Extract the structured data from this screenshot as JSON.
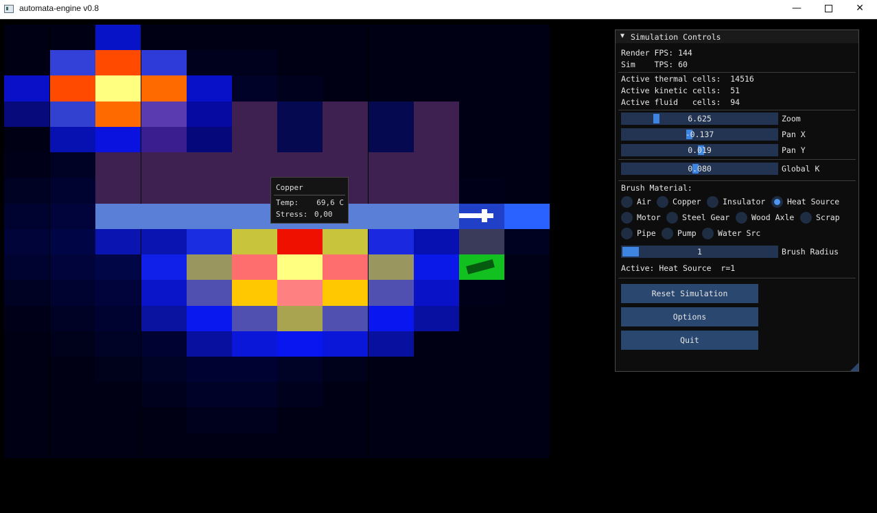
{
  "window": {
    "title": "automata-engine v0.8",
    "min_glyph": "—",
    "close_glyph": "✕"
  },
  "tooltip": {
    "title": "Copper",
    "temp_label": "Temp:",
    "temp_value": "69,6 C",
    "stress_label": "Stress:",
    "stress_value": "0,00"
  },
  "panel": {
    "collapse_glyph": "▼",
    "title": "Simulation Controls",
    "render_fps": "Render FPS: 144",
    "sim_tps": "Sim    TPS: 60",
    "thermal": "Active thermal cells:  14516",
    "kinetic": "Active kinetic cells:  51",
    "fluid": "Active fluid   cells:  94",
    "sliders": [
      {
        "label": "Zoom",
        "value": "6.625",
        "fraction": 0.21
      },
      {
        "label": "Pan X",
        "value": "-0.137",
        "fraction": 0.43
      },
      {
        "label": "Pan Y",
        "value": "0.019",
        "fraction": 0.51
      },
      {
        "label": "Global K",
        "value": "0.080",
        "fraction": 0.47
      }
    ],
    "brush_material_label": "Brush Material:",
    "materials": [
      {
        "label": "Air",
        "selected": false
      },
      {
        "label": "Copper",
        "selected": false
      },
      {
        "label": "Insulator",
        "selected": false
      },
      {
        "label": "Heat Source",
        "selected": true
      },
      {
        "label": "Motor",
        "selected": false
      },
      {
        "label": "Steel Gear",
        "selected": false
      },
      {
        "label": "Wood Axle",
        "selected": false
      },
      {
        "label": "Scrap",
        "selected": false
      },
      {
        "label": "Pipe",
        "selected": false
      },
      {
        "label": "Pump",
        "selected": false
      },
      {
        "label": "Water Src",
        "selected": false
      }
    ],
    "brush_radius": {
      "label": "Brush Radius",
      "value": "1",
      "fraction": 0.0
    },
    "active_status": "Active: Heat Source  r=1",
    "buttons": {
      "reset": "Reset Simulation",
      "options": "Options",
      "quit": "Quit"
    }
  },
  "colors": {
    "accent": "#3d85e0",
    "slider_bg": "#223451",
    "button_bg": "#2a4770"
  }
}
